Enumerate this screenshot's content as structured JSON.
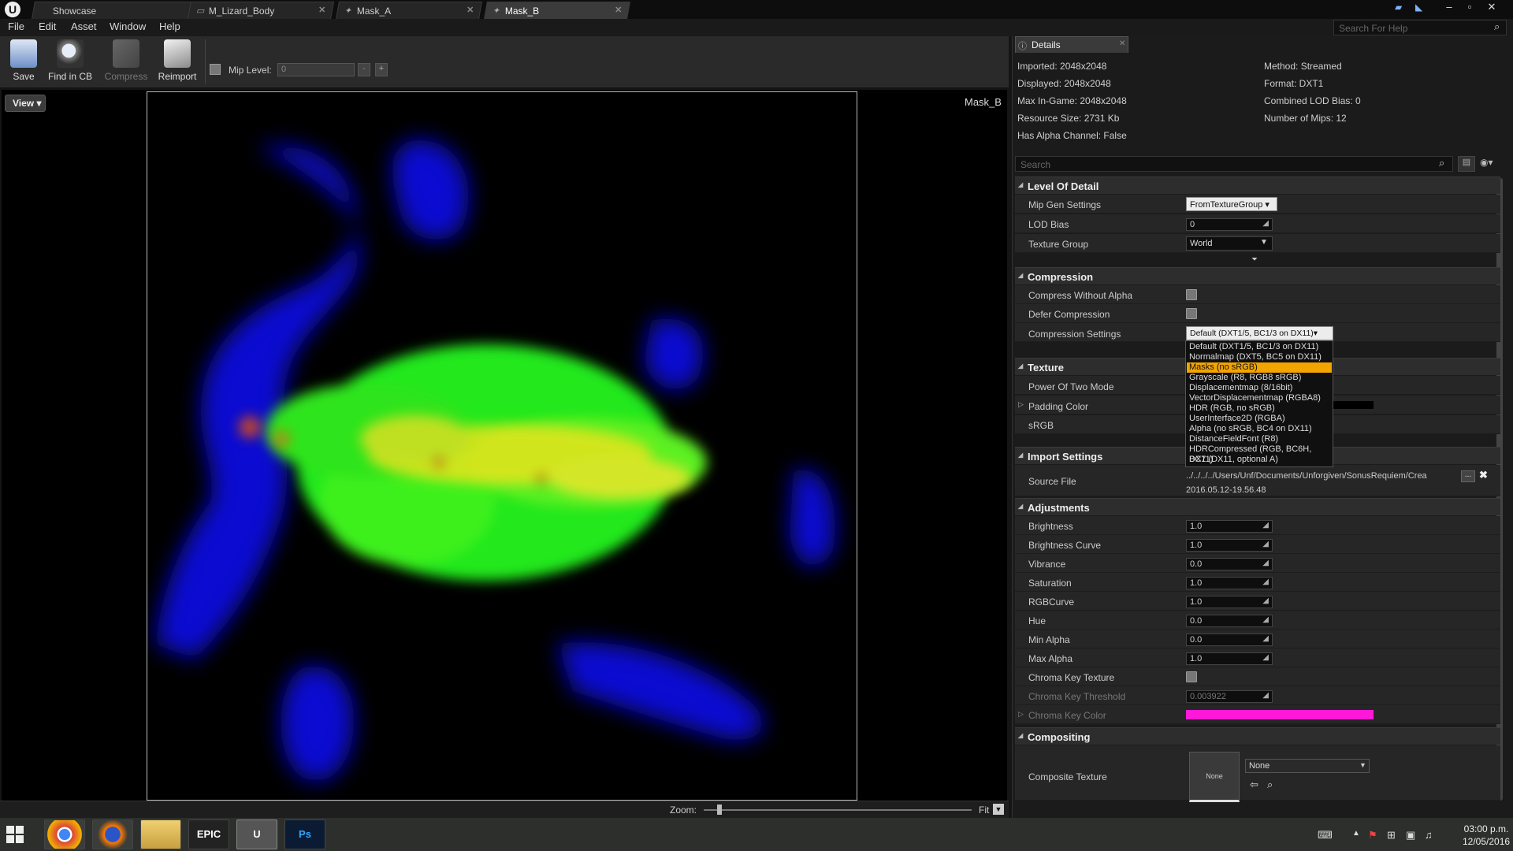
{
  "tabs": [
    {
      "label": "Showcase"
    },
    {
      "label": "M_Lizard_Body"
    },
    {
      "label": "Mask_A"
    },
    {
      "label": "Mask_B"
    }
  ],
  "menu": [
    "File",
    "Edit",
    "Asset",
    "Window",
    "Help"
  ],
  "help_search_placeholder": "Search For Help",
  "toolbar": {
    "save": "Save",
    "find": "Find in CB",
    "compress": "Compress",
    "reimport": "Reimport",
    "mip_label": "Mip Level:",
    "mip_value": "0",
    "minus": "-",
    "plus": "+"
  },
  "viewport": {
    "view_label": "View",
    "texture_name": "Mask_B",
    "zoom_label": "Zoom:",
    "fit_label": "Fit"
  },
  "details": {
    "tab": "Details",
    "info_left": [
      "Imported: 2048x2048",
      "Displayed: 2048x2048",
      "Max In-Game: 2048x2048",
      "Resource Size: 2731 Kb",
      "Has Alpha Channel: False"
    ],
    "info_right": [
      "Method: Streamed",
      "Format: DXT1",
      "Combined LOD Bias: 0",
      "Number of Mips: 12"
    ],
    "search_placeholder": "Search",
    "sections": {
      "lod": "Level Of Detail",
      "compression": "Compression",
      "texture": "Texture",
      "import": "Import Settings",
      "adjust": "Adjustments",
      "compositing": "Compositing"
    },
    "lod": {
      "mip_gen_label": "Mip Gen Settings",
      "mip_gen_value": "FromTextureGroup",
      "lod_bias_label": "LOD Bias",
      "lod_bias_value": "0",
      "texture_group_label": "Texture Group",
      "texture_group_value": "World"
    },
    "compression": {
      "without_alpha": "Compress Without Alpha",
      "defer": "Defer Compression",
      "settings_label": "Compression Settings",
      "settings_value": "Default (DXT1/5, BC1/3 on DX11)"
    },
    "dropdown_options": [
      "Default (DXT1/5, BC1/3 on DX11)",
      "Normalmap (DXT5, BC5 on DX11)",
      "Masks (no sRGB)",
      "Grayscale (R8, RGB8 sRGB)",
      "Displacementmap (8/16bit)",
      "VectorDisplacementmap (RGBA8)",
      "HDR (RGB, no sRGB)",
      "UserInterface2D (RGBA)",
      "Alpha (no sRGB, BC4 on DX11)",
      "DistanceFieldFont (R8)",
      "HDRCompressed (RGB, BC6H, DX11)",
      "BC7 (DX11, optional A)"
    ],
    "texture": {
      "power_of_two": "Power Of Two Mode",
      "padding_color": "Padding Color",
      "srgb": "sRGB"
    },
    "import": {
      "source_label": "Source File",
      "source_path": "../../../../Users/Unf/Documents/Unforgiven/SonusRequiem/Crea",
      "source_date": "2016.05.12-19.56.48",
      "browse": "..."
    },
    "adjustments": [
      {
        "label": "Brightness",
        "value": "1.0"
      },
      {
        "label": "Brightness Curve",
        "value": "1.0"
      },
      {
        "label": "Vibrance",
        "value": "0.0"
      },
      {
        "label": "Saturation",
        "value": "1.0"
      },
      {
        "label": "RGBCurve",
        "value": "1.0"
      },
      {
        "label": "Hue",
        "value": "0.0"
      },
      {
        "label": "Min Alpha",
        "value": "0.0"
      },
      {
        "label": "Max Alpha",
        "value": "1.0"
      }
    ],
    "chroma": {
      "texture": "Chroma Key Texture",
      "threshold": "Chroma Key Threshold",
      "threshold_value": "0.003922",
      "color": "Chroma Key Color"
    },
    "composite": {
      "label": "Composite Texture",
      "thumb": "None",
      "value": "None"
    }
  },
  "taskbar": {
    "epic": "EPIC",
    "unreal": "U",
    "ps": "Ps",
    "time": "03:00 p.m.",
    "date": "12/05/2016"
  },
  "colors": {
    "chroma_key": "#ff18d8",
    "highlight": "#f2a400"
  }
}
